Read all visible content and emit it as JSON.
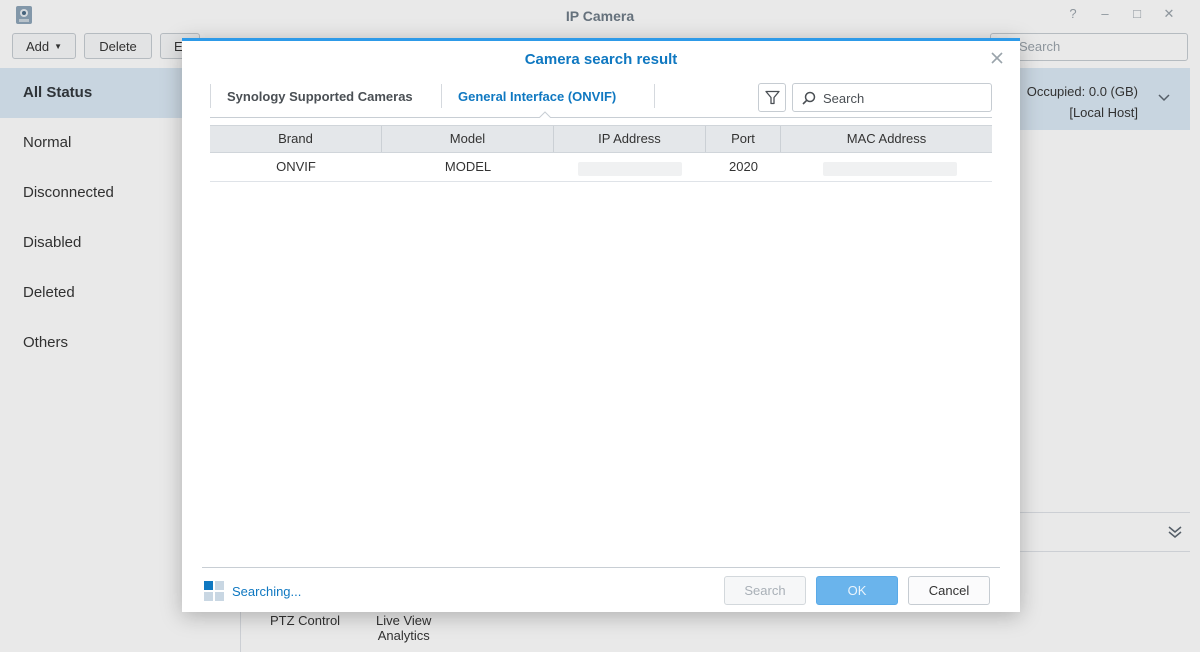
{
  "app": {
    "title": "IP Camera",
    "toolbar": {
      "add_label": "Add",
      "delete_label": "Delete",
      "edit_label": "E",
      "search_placeholder": "Search"
    },
    "sidebar": {
      "items": [
        "All Status",
        "Normal",
        "Disconnected",
        "Disabled",
        "Deleted",
        "Others"
      ],
      "active_index": 0
    },
    "info": {
      "occupied": "Occupied: 0.0 (GB)",
      "host": "[Local Host]"
    },
    "bottom": {
      "ptz_label": "PTZ Control",
      "live_view_line1": "Live View",
      "live_view_line2": "Analytics"
    }
  },
  "dialog": {
    "title": "Camera search result",
    "tabs": [
      {
        "label": "Synology Supported Cameras",
        "active": false
      },
      {
        "label": "General Interface (ONVIF)",
        "active": true
      }
    ],
    "search_placeholder": "Search",
    "columns": [
      "Brand",
      "Model",
      "IP Address",
      "Port",
      "MAC Address"
    ],
    "rows": [
      {
        "brand": "ONVIF",
        "model": "MODEL",
        "ip": "",
        "port": "2020",
        "mac": ""
      }
    ],
    "status": "Searching...",
    "buttons": {
      "search": "Search",
      "ok": "OK",
      "cancel": "Cancel"
    }
  },
  "colors": {
    "accent": "#0f78c1",
    "top_border": "#2d9ae8",
    "ok_button": "#6ab4ec"
  },
  "icons": [
    "camera-app-icon",
    "help-icon",
    "minimize-icon",
    "maximize-icon",
    "close-icon",
    "search-icon",
    "chevron-down-icon",
    "double-chevron-down-icon",
    "filter-icon",
    "spinner-icon"
  ]
}
